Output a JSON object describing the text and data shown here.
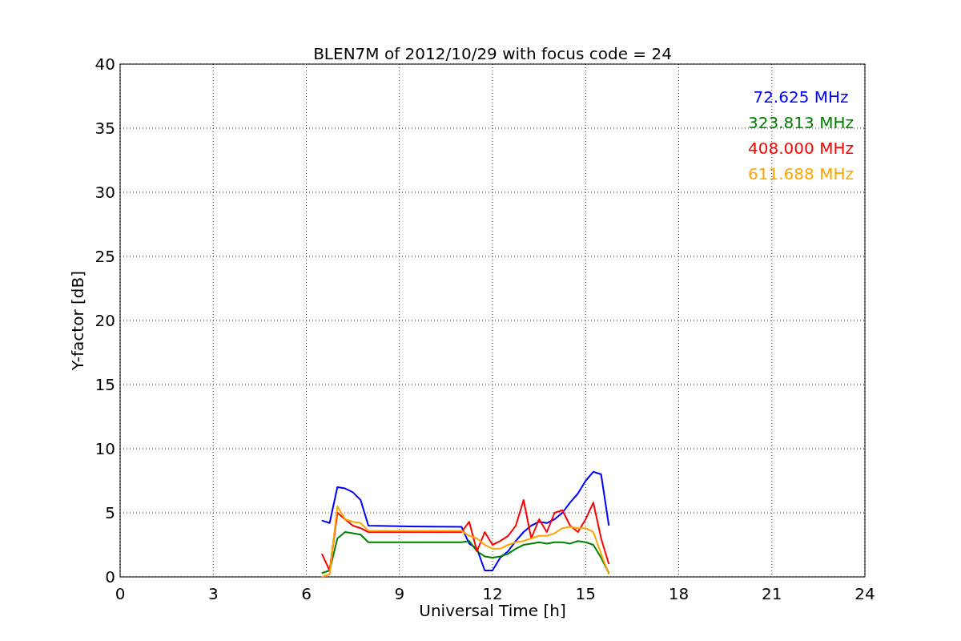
{
  "chart_data": {
    "type": "line",
    "title": "BLEN7M of 2012/10/29 with focus code = 24",
    "xlabel": "Universal Time [h]",
    "ylabel": "Y-factor [dB]",
    "x": [
      6.5,
      6.75,
      7,
      7.25,
      7.5,
      7.75,
      8,
      9,
      10,
      11,
      11.25,
      11.5,
      11.75,
      12,
      12.25,
      12.5,
      12.75,
      13,
      13.25,
      13.5,
      13.75,
      14,
      14.25,
      14.5,
      14.75,
      15,
      15.25,
      15.5,
      15.75
    ],
    "series": [
      {
        "name": "72.625 MHz",
        "color": "#0000ff",
        "values": [
          4.4,
          4.2,
          7.0,
          6.9,
          6.6,
          6.0,
          4.0,
          3.95,
          3.92,
          3.9,
          2.6,
          2.2,
          0.5,
          0.5,
          1.5,
          2.0,
          2.8,
          3.5,
          4.0,
          4.3,
          4.2,
          4.5,
          5.0,
          5.8,
          6.5,
          7.5,
          8.2,
          8.0,
          4.0
        ]
      },
      {
        "name": "323.813 MHz",
        "color": "#008000",
        "values": [
          0.3,
          0.5,
          3.0,
          3.5,
          3.4,
          3.3,
          2.7,
          2.7,
          2.7,
          2.7,
          2.8,
          2.0,
          1.6,
          1.5,
          1.6,
          1.8,
          2.2,
          2.5,
          2.6,
          2.7,
          2.6,
          2.7,
          2.7,
          2.6,
          2.8,
          2.7,
          2.5,
          1.5,
          0.3
        ]
      },
      {
        "name": "408.000 MHz",
        "color": "#ff0000",
        "values": [
          1.8,
          0.5,
          5.0,
          4.5,
          4.0,
          3.8,
          3.5,
          3.5,
          3.5,
          3.5,
          4.3,
          2.0,
          3.5,
          2.5,
          2.8,
          3.2,
          4.0,
          6.0,
          3.0,
          4.5,
          3.5,
          5.0,
          5.2,
          4.0,
          3.5,
          4.5,
          5.8,
          3.0,
          1.0
        ]
      },
      {
        "name": "611.688 MHz",
        "color": "#ffa500",
        "values": [
          0.0,
          0.2,
          5.5,
          4.5,
          4.3,
          4.2,
          3.6,
          3.6,
          3.6,
          3.6,
          3.2,
          3.0,
          2.5,
          2.2,
          2.2,
          2.5,
          2.7,
          2.8,
          3.0,
          3.2,
          3.2,
          3.4,
          3.8,
          3.9,
          3.8,
          3.8,
          3.5,
          1.8,
          0.2
        ]
      }
    ],
    "xlim": [
      0,
      24
    ],
    "ylim": [
      0,
      40
    ],
    "xticks": [
      0,
      3,
      6,
      9,
      12,
      15,
      18,
      21,
      24
    ],
    "yticks": [
      0,
      5,
      10,
      15,
      20,
      25,
      30,
      35,
      40
    ],
    "grid": true
  }
}
